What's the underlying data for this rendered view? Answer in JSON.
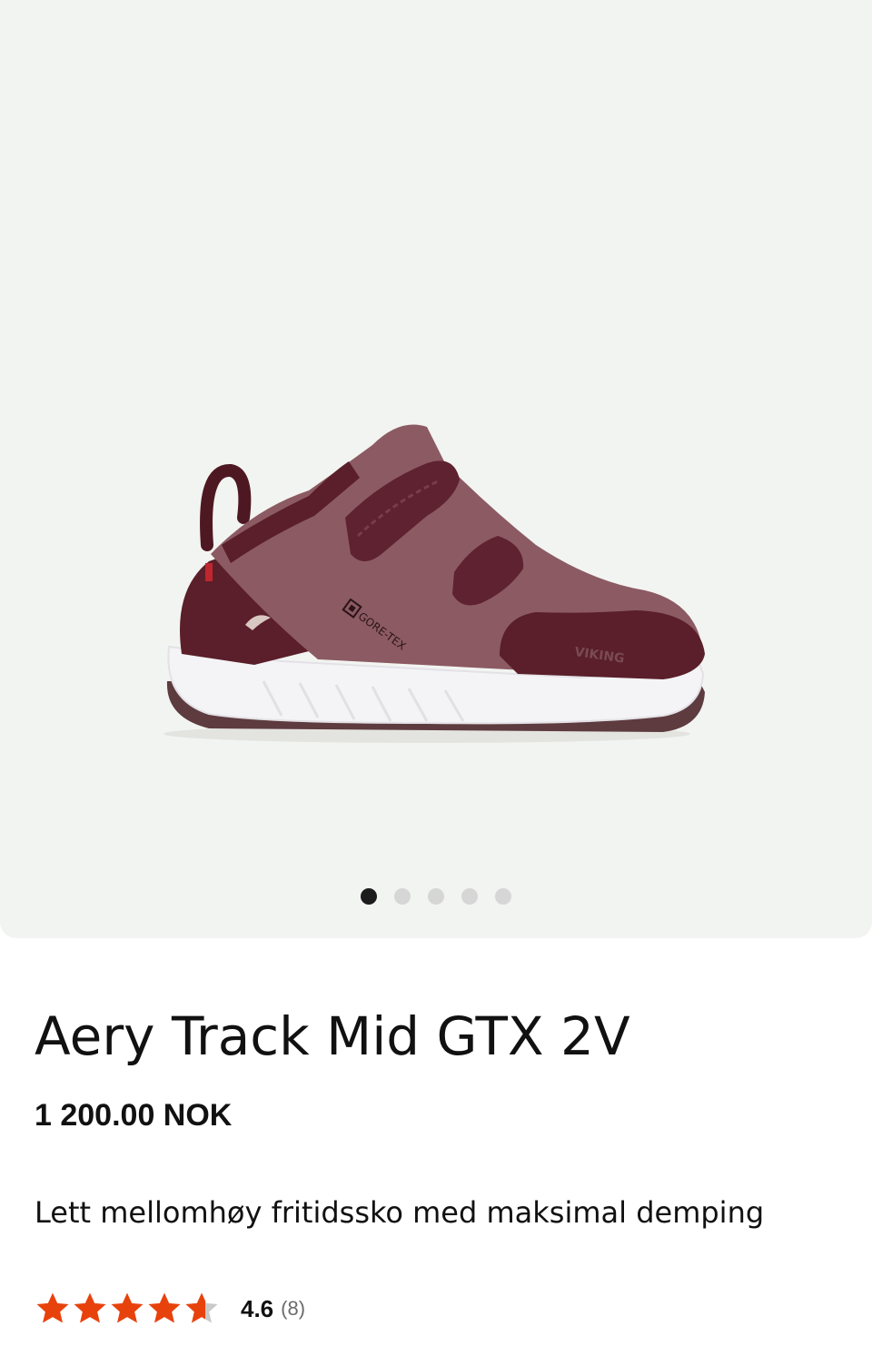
{
  "gallery": {
    "image_alt": "Aery Track Mid GTX 2V shoe",
    "badge_text": "GORE-TEX",
    "brand_text": "VIKING",
    "dots": 5,
    "active_dot": 0
  },
  "product": {
    "title": "Aery Track Mid GTX 2V",
    "price": "1 200.00 NOK",
    "description": "Lett mellomhøy fritidssko med maksimal demping"
  },
  "rating": {
    "value": "4.6",
    "count": "(8)",
    "stars_filled": 4.6,
    "stars_total": 5
  },
  "colors": {
    "star": "#e8420c",
    "star_empty": "#c9c9c9",
    "gallery_bg": "#f2f4f1",
    "shoe_main": "#8c5a63",
    "shoe_dark": "#5a1f2a",
    "sole": "#f3f3f6"
  }
}
